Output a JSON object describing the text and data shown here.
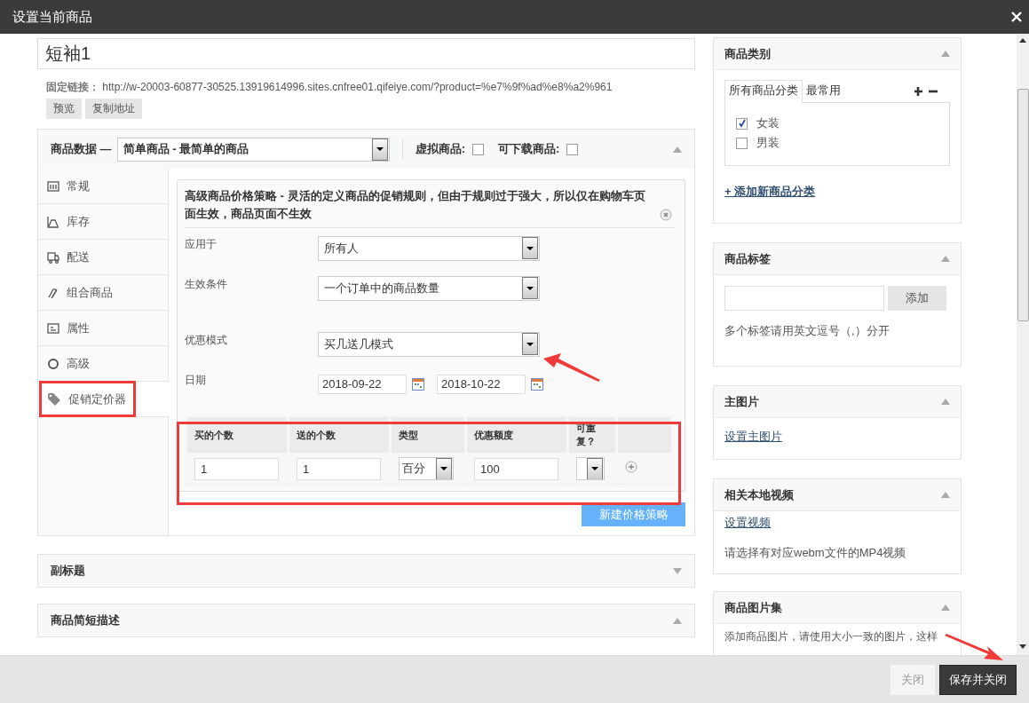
{
  "window": {
    "title": "设置当前商品"
  },
  "product_title": {
    "value": "短袖1"
  },
  "permalink": {
    "label": "固定链接：",
    "url": "http://w-20003-60877-30525.13919614996.sites.cnfree01.qifeiye.com/?product=%e7%9f%ad%e8%a2%961"
  },
  "permalink_buttons": [
    "预览",
    "复制地址"
  ],
  "product_data": {
    "label": "商品数据 —",
    "type_select": "简单商品 - 最简单的商品",
    "expanded": true,
    "options": [
      {
        "label": "虚拟商品:",
        "checked": false
      },
      {
        "label": "可下载商品:",
        "checked": false
      }
    ],
    "tabs": [
      {
        "kind": "general",
        "label": "常规",
        "selected": false
      },
      {
        "kind": "inventory",
        "label": "库存",
        "selected": false
      },
      {
        "kind": "shipping",
        "label": "配送",
        "selected": false
      },
      {
        "kind": "linked",
        "label": "组合商品",
        "selected": false
      },
      {
        "kind": "attributes",
        "label": "属性",
        "selected": false
      },
      {
        "kind": "advanced",
        "label": "高级",
        "selected": false
      },
      {
        "kind": "promo",
        "label": "促销定价器",
        "selected": true
      }
    ],
    "pricing": {
      "title": "高级商品价格策略 - 灵活的定义商品的促销规则，但由于规则过于强大，所以仅在购物车页面生效，商品页面不生效",
      "fields": [
        {
          "kind": "select",
          "label": "应用于",
          "value": "所有人"
        },
        {
          "kind": "select",
          "label": "生效条件",
          "value": "一个订单中的商品数量"
        },
        {
          "kind": "select",
          "label": "优惠模式",
          "value": "买几送几模式"
        },
        {
          "kind": "dates",
          "label": "日期",
          "from": "2018-09-22",
          "to": "2018-10-22"
        }
      ],
      "table": {
        "columns": [
          "买的个数",
          "送的个数",
          "类型",
          "优惠额度",
          "可重复？"
        ],
        "rows": [
          {
            "cells": [
              {
                "kind": "input",
                "value": "1"
              },
              {
                "kind": "input",
                "value": "1"
              },
              {
                "kind": "select",
                "value": "百分"
              },
              {
                "kind": "input",
                "value": "100"
              },
              {
                "kind": "select"
              }
            ]
          }
        ]
      },
      "new_button": "新建价格策略"
    }
  },
  "panels": [
    {
      "title": "副标题",
      "expanded": false
    },
    {
      "title": "商品简短描述",
      "expanded": true
    }
  ],
  "side_panels": [
    {
      "kind": "categories",
      "title": "商品类别",
      "expanded": true,
      "tabs": [
        {
          "label": "所有商品分类",
          "selected": true
        },
        {
          "label": "最常用",
          "selected": false
        }
      ],
      "items": [
        {
          "label": "女装",
          "checked": true
        },
        {
          "label": "男装",
          "checked": false
        }
      ],
      "link": "+ 添加新商品分类"
    },
    {
      "kind": "tags",
      "title": "商品标签",
      "expanded": true,
      "button": "添加",
      "hint": "多个标签请用英文逗号（,）分开"
    },
    {
      "kind": "link",
      "title": "主图片",
      "expanded": true,
      "link": "设置主图片"
    },
    {
      "kind": "link",
      "title": "相关本地视频",
      "expanded": true,
      "link": "设置视频",
      "hint": "请选择有对应webm文件的MP4视频"
    },
    {
      "kind": "text",
      "title": "商品图片集",
      "expanded": true,
      "hint": "添加商品图片，请使用大小一致的图片，这样"
    }
  ],
  "footer_buttons": [
    {
      "label": "关闭",
      "kind": "secondary"
    },
    {
      "label": "保存并关闭",
      "kind": "primary"
    }
  ]
}
